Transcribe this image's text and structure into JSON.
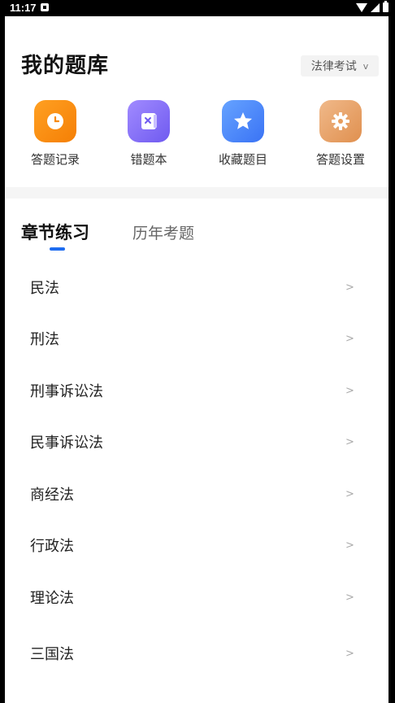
{
  "status_bar": {
    "time": "11:17"
  },
  "header": {
    "title": "我的题库",
    "exam_select": {
      "value": "法律考试",
      "chevron": "v"
    }
  },
  "shortcuts": [
    {
      "label": "答题记录",
      "icon": "clock-icon",
      "color": "#f7890f"
    },
    {
      "label": "错题本",
      "icon": "wrong-book-icon",
      "color": "#7e69f5"
    },
    {
      "label": "收藏题目",
      "icon": "star-icon",
      "color": "#4a86fa"
    },
    {
      "label": "答题设置",
      "icon": "gear-icon",
      "color": "#e79d5e"
    }
  ],
  "tabs": [
    {
      "label": "章节练习",
      "active": true
    },
    {
      "label": "历年考题",
      "active": false
    }
  ],
  "accent": "#1e6cf0",
  "chapters": [
    {
      "name": "民法",
      "arrow": ">"
    },
    {
      "name": "刑法",
      "arrow": ">"
    },
    {
      "name": "刑事诉讼法",
      "arrow": ">"
    },
    {
      "name": "民事诉讼法",
      "arrow": ">"
    },
    {
      "name": "商经法",
      "arrow": ">"
    },
    {
      "name": "行政法",
      "arrow": ">"
    },
    {
      "name": "理论法",
      "arrow": ">"
    },
    {
      "name": "三国法",
      "arrow": ">"
    }
  ]
}
